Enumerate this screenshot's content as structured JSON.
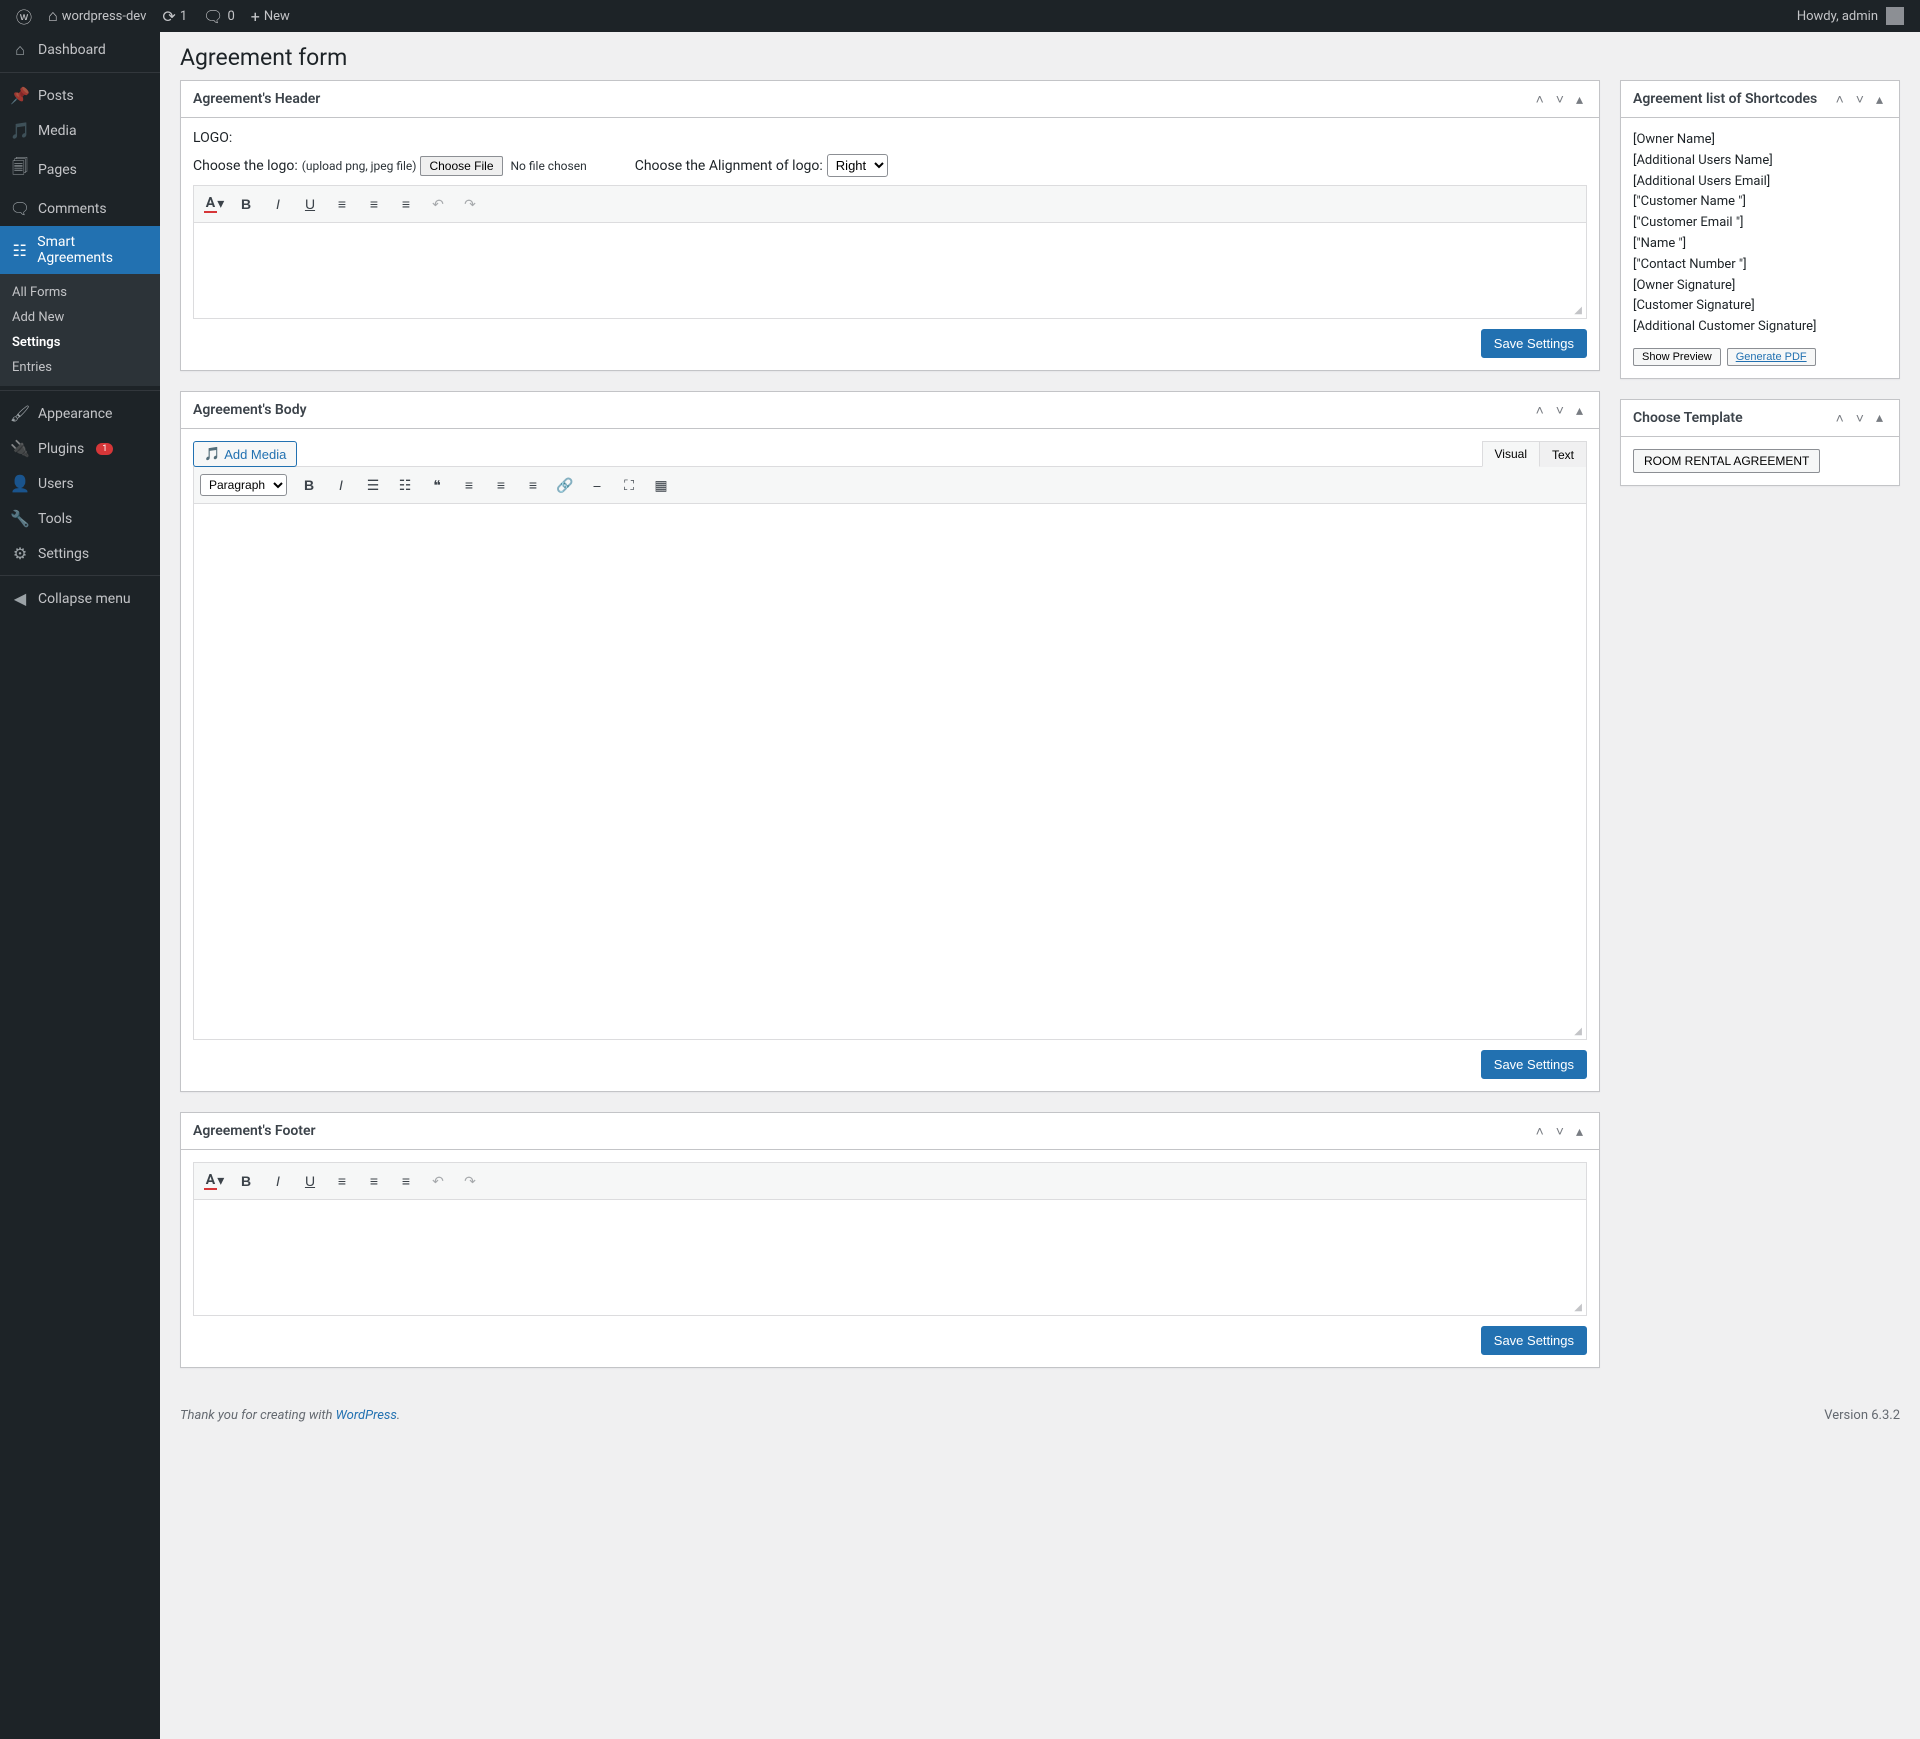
{
  "adminbar": {
    "site": "wordpress-dev",
    "updates": "1",
    "comments": "0",
    "new": "New",
    "howdy": "Howdy, admin"
  },
  "menu": {
    "dashboard": "Dashboard",
    "posts": "Posts",
    "media": "Media",
    "pages": "Pages",
    "comments": "Comments",
    "smart": "Smart Agreements",
    "smart_sub": {
      "all": "All Forms",
      "add": "Add New",
      "settings": "Settings",
      "entries": "Entries"
    },
    "appearance": "Appearance",
    "plugins": "Plugins",
    "plugins_badge": "1",
    "users": "Users",
    "tools": "Tools",
    "settings": "Settings",
    "collapse": "Collapse menu"
  },
  "page": {
    "title": "Agreement form"
  },
  "header_box": {
    "title": "Agreement's Header",
    "logo_label": "LOGO:",
    "choose_logo": "Choose the logo:",
    "hint": "(upload png, jpeg file)",
    "choose_file": "Choose File",
    "no_file": "No file chosen",
    "align_label": "Choose the Alignment of logo:",
    "align_value": "Right",
    "save": "Save Settings"
  },
  "body_box": {
    "title": "Agreement's Body",
    "add_media": "Add Media",
    "tab_visual": "Visual",
    "tab_text": "Text",
    "paragraph": "Paragraph",
    "save": "Save Settings"
  },
  "footer_box": {
    "title": "Agreement's Footer",
    "save": "Save Settings"
  },
  "shortcodes_box": {
    "title": "Agreement list of Shortcodes",
    "items": [
      "[Owner Name]",
      "[Additional Users Name]",
      "[Additional Users Email]",
      "[\"Customer Name \"]",
      "[\"Customer Email \"]",
      "[\"Name \"]",
      "[\"Contact Number \"]",
      "[Owner Signature]",
      "[Customer Signature]",
      "[Additional Customer Signature]"
    ],
    "show_preview": "Show Preview",
    "generate_pdf": "Generate PDF"
  },
  "template_box": {
    "title": "Choose Template",
    "button": "ROOM RENTAL AGREEMENT"
  },
  "footer": {
    "thanks_prefix": "Thank you for creating with ",
    "wp": "WordPress",
    "version": "Version 6.3.2"
  }
}
